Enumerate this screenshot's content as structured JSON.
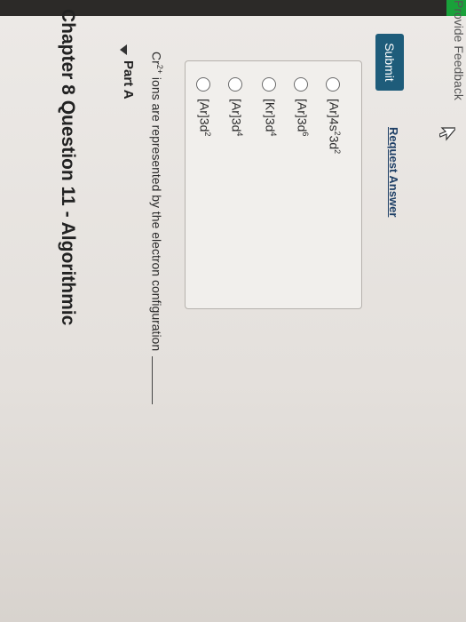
{
  "header": {
    "title": "Chapter 8 Question 11 - Algorithmic"
  },
  "part": {
    "label": "Part A"
  },
  "question": {
    "prefix": "Cr",
    "superscript": "2+",
    "text": " ions are represented by the electron configuration"
  },
  "options": [
    {
      "base": "[Ar]3d",
      "sup": "2",
      "rest": "",
      "rest_sup": ""
    },
    {
      "base": "[Ar]3d",
      "sup": "4",
      "rest": "",
      "rest_sup": ""
    },
    {
      "base": "[Kr]3d",
      "sup": "4",
      "rest": "",
      "rest_sup": ""
    },
    {
      "base": "[Ar]3d",
      "sup": "6",
      "rest": "",
      "rest_sup": ""
    },
    {
      "base": "[Ar]4s",
      "sup": "2",
      "rest": "3d",
      "rest_sup": "2"
    }
  ],
  "actions": {
    "submit_label": "Submit",
    "request_answer_label": "Request Answer"
  },
  "footer": {
    "feedback_label": "Provide Feedback"
  },
  "colors": {
    "submit_bg": "#1e5c7a",
    "link": "#1e3f66",
    "brand_strip": "#19a13a"
  }
}
